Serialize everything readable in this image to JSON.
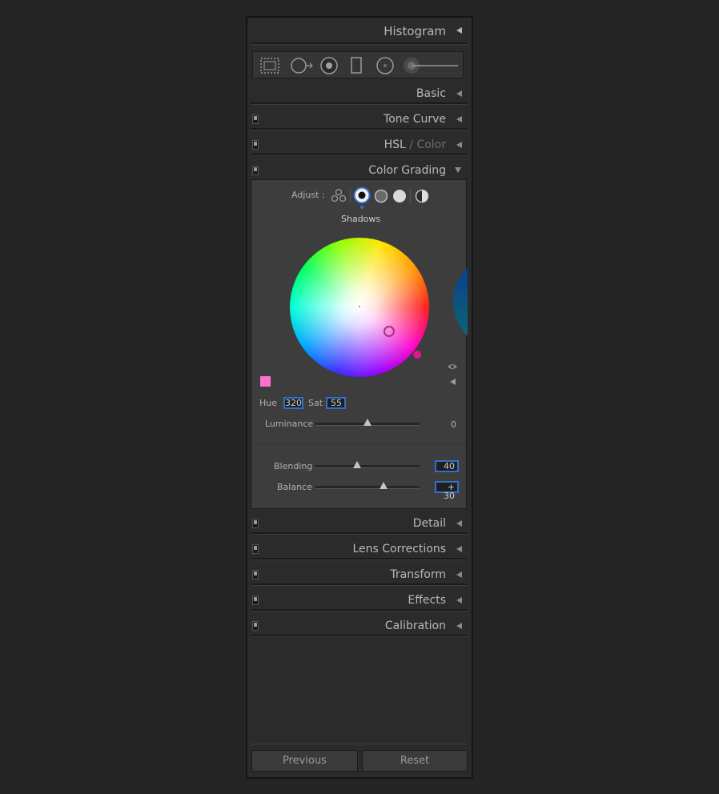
{
  "panel": {
    "histogram_title": "Histogram",
    "sections": {
      "basic": "Basic",
      "tone_curve": "Tone Curve",
      "hsl": "HSL",
      "hsl_sep": "/",
      "hsl_color": "Color",
      "color_grading": "Color Grading",
      "detail": "Detail",
      "lens_corrections": "Lens Corrections",
      "transform": "Transform",
      "effects": "Effects",
      "calibration": "Calibration"
    },
    "tools": [
      "crop-overlay-icon",
      "spot-removal-icon",
      "red-eye-icon",
      "graduated-filter-icon",
      "radial-filter-icon",
      "adjustment-brush-icon"
    ]
  },
  "color_grading": {
    "adjust_label": "Adjust :",
    "modes": [
      "3-way-icon",
      "shadows-icon",
      "midtones-icon",
      "highlights-icon",
      "global-icon"
    ],
    "selected_mode": "Shadows",
    "swatch_color": "#ff6fcf",
    "hue_label": "Hue",
    "hue_value": "320",
    "sat_label": "Sat",
    "sat_value": "55",
    "luminance_label": "Luminance",
    "luminance_value": "0",
    "luminance_level": 0.5,
    "blending_label": "Blending",
    "blending_value": "40",
    "blending_level": 0.4,
    "balance_label": "Balance",
    "balance_value": "+ 30",
    "balance_level": 0.65
  },
  "footer": {
    "previous_label": "Previous",
    "reset_label": "Reset"
  },
  "colors": {
    "accent": "#2f6fd1",
    "handle": "#e0168f"
  }
}
